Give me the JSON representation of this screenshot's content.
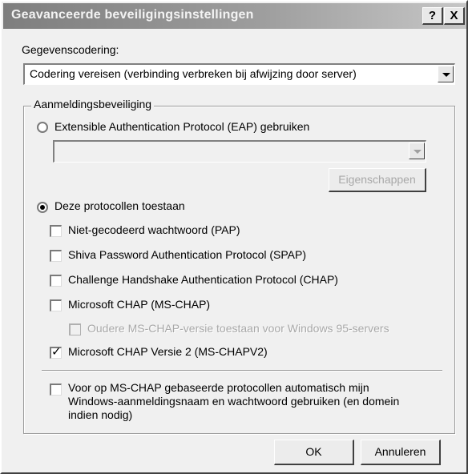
{
  "window": {
    "title": "Geavanceerde beveiligingsinstellingen",
    "help_label": "?",
    "close_label": "X"
  },
  "encryption": {
    "label": "Gegevenscodering:",
    "selected": "Codering vereisen (verbinding verbreken bij afwijzing door server)"
  },
  "logon": {
    "group_label": "Aanmeldingsbeveiliging",
    "eap_radio_label": "Extensible Authentication Protocol (EAP) gebruiken",
    "eap_radio_selected": false,
    "eap_select_value": "",
    "properties_button": "Eigenschappen",
    "protocols_radio_label": "Deze protocollen toestaan",
    "protocols_radio_selected": true,
    "protocols": [
      {
        "label": "Niet-gecodeerd wachtwoord (PAP)",
        "checked": false,
        "enabled": true
      },
      {
        "label": "Shiva Password Authentication Protocol (SPAP)",
        "checked": false,
        "enabled": true
      },
      {
        "label": "Challenge Handshake Authentication Protocol (CHAP)",
        "checked": false,
        "enabled": true
      },
      {
        "label": "Microsoft CHAP (MS-CHAP)",
        "checked": false,
        "enabled": true
      },
      {
        "label": "Oudere MS-CHAP-versie toestaan voor Windows 95-servers",
        "checked": false,
        "enabled": false
      },
      {
        "label": "Microsoft CHAP Versie 2 (MS-CHAPV2)",
        "checked": true,
        "enabled": true
      }
    ],
    "auto_logon_label": "Voor op MS-CHAP gebaseerde protocollen automatisch mijn Windows-aanmeldingsnaam en wachtwoord gebruiken (en domein indien nodig)",
    "auto_logon_checked": false
  },
  "buttons": {
    "ok": "OK",
    "cancel": "Annuleren"
  }
}
